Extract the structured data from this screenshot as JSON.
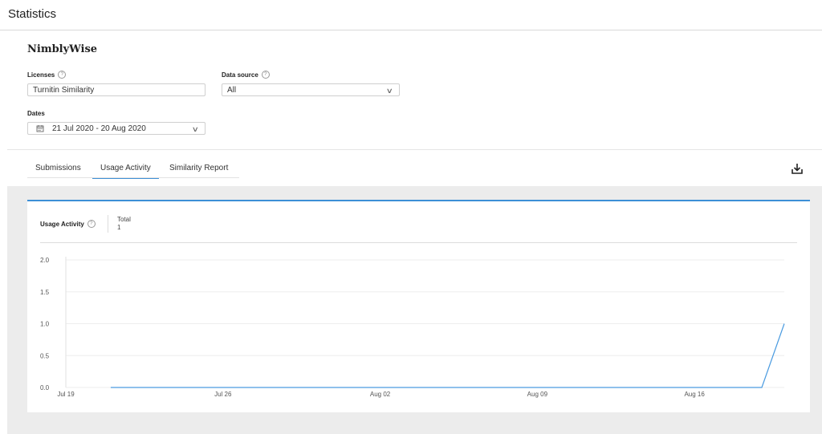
{
  "header": {
    "title": "Statistics"
  },
  "institution": {
    "name": "NimblyWise"
  },
  "filters": {
    "licenses": {
      "label": "Licenses",
      "value": "Turnitin Similarity"
    },
    "data_source": {
      "label": "Data source",
      "value": "All"
    },
    "dates": {
      "label": "Dates",
      "value": "21 Jul 2020 - 20 Aug 2020"
    }
  },
  "tabs": [
    {
      "label": "Submissions",
      "active": false
    },
    {
      "label": "Usage Activity",
      "active": true
    },
    {
      "label": "Similarity Report",
      "active": false
    }
  ],
  "icons": {
    "download": "download-icon",
    "calendar": "calendar-icon",
    "help": "help-icon",
    "dropdown": "chevron-down-icon"
  },
  "colors": {
    "accent": "#3d8fd6",
    "line": "#4a9be0"
  },
  "usage_card": {
    "title": "Usage Activity",
    "total_label": "Total",
    "total_value": "1"
  },
  "chart_data": {
    "type": "line",
    "title": "",
    "xlabel": "",
    "ylabel": "",
    "ylim": [
      0,
      2.0
    ],
    "y_ticks": [
      "0.0",
      "0.5",
      "1.0",
      "1.5",
      "2.0"
    ],
    "x_tick_labels": [
      "Jul 19",
      "Jul 26",
      "Aug 02",
      "Aug 09",
      "Aug 16"
    ],
    "xlim": [
      "2020-07-19",
      "2020-08-20"
    ],
    "grid": true,
    "series": [
      {
        "name": "",
        "x": [
          "2020-07-21",
          "2020-08-19",
          "2020-08-20"
        ],
        "y": [
          0,
          0,
          1
        ]
      }
    ]
  }
}
